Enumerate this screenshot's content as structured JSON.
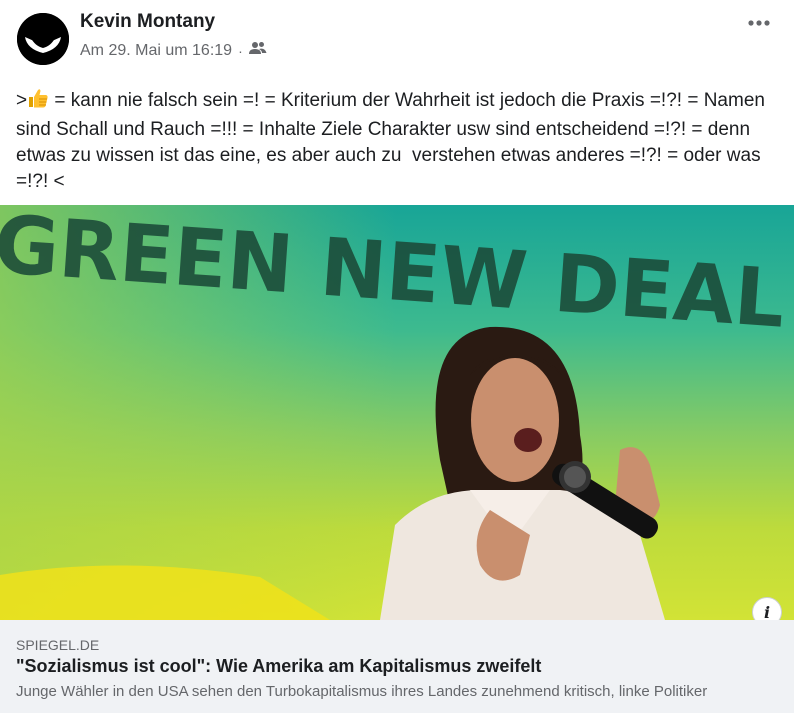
{
  "post": {
    "author": "Kevin Montany",
    "timestamp": "Am 29. Mai um 16:19",
    "separator": "·",
    "audience_icon": "friends-icon",
    "more_icon": "more-horizontal-icon",
    "text_prefix": ">",
    "thumb_icon": "thumbs-up-emoji",
    "text": " = kann nie falsch sein =! = Kriterium der Wahrheit ist jedoch die Praxis =!?! = Namen sind Schall und Rauch =!!! = Inhalte Ziele Charakter usw sind entscheidend =!?! = denn etwas zu wissen ist das eine, es aber auch zu  verstehen etwas anderes =!?! = oder was =!?! <"
  },
  "link_preview": {
    "image_text": "GREEN NEW DEAL",
    "domain": "SPIEGEL.DE",
    "title": "\"Sozialismus ist cool\": Wie Amerika am Kapitalismus zweifelt",
    "description": "Junge Wähler in den USA sehen den Turbokapitalismus ihres Landes zunehmend kritisch, linke Politiker",
    "info_label": "i"
  },
  "colors": {
    "primary_text": "#1c1e21",
    "secondary_text": "#65676b",
    "card_background": "#f0f2f5"
  }
}
